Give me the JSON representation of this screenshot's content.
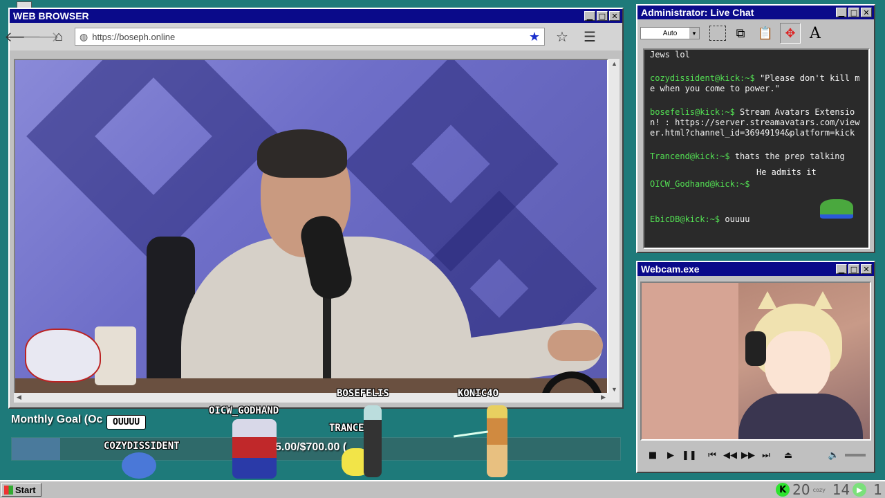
{
  "browser": {
    "title": "WEB BROWSER",
    "url": "https://boseph.online",
    "controls": {
      "minimize": "▁",
      "maximize": "□",
      "close": "✕"
    }
  },
  "chat": {
    "title": "Administrator: Live Chat",
    "select_value": "Auto",
    "messages": [
      {
        "user": "",
        "text": "Jews lol"
      },
      {
        "user": "cozydissident@kick:~$",
        "text": " \"Please don't kill me when you come to power.\""
      },
      {
        "user": "bosefelis@kick:~$",
        "text": " Stream Avatars Extension! : https://server.streamavatars.com/viewer.html?channel_id=36949194&platform=kick"
      },
      {
        "user": "Trancend@kick:~$",
        "text": " thats the prep talking"
      },
      {
        "user": "",
        "text": "He admits it"
      },
      {
        "user": "OICW_Godhand@kick:~$",
        "text": ""
      },
      {
        "user": "EbicDB@kick:~$",
        "text": " ouuuu"
      }
    ]
  },
  "webcam": {
    "title": "Webcam.exe"
  },
  "goal": {
    "label": "Monthly Goal (Oc",
    "amount": "5.00/$700.00 (",
    "progress_fraction": 0.08
  },
  "avatars": [
    {
      "name": "COZYDISSIDENT",
      "bubble": "OUUUU"
    },
    {
      "name": "OICW_GODHAND"
    },
    {
      "name": "BOSEFELIS"
    },
    {
      "name": "TRANCEND"
    },
    {
      "name": "KONIC4O"
    }
  ],
  "taskbar": {
    "start": "Start",
    "tray_count_1": "20",
    "tray_cozy": "cozy",
    "tray_count_2": "14",
    "tray_count_3": "1"
  },
  "colors": {
    "desktop": "#1e7a7a",
    "titlebar": "#0a0a8a",
    "chat_user": "#53e053",
    "kick_green": "#2ee32e"
  }
}
